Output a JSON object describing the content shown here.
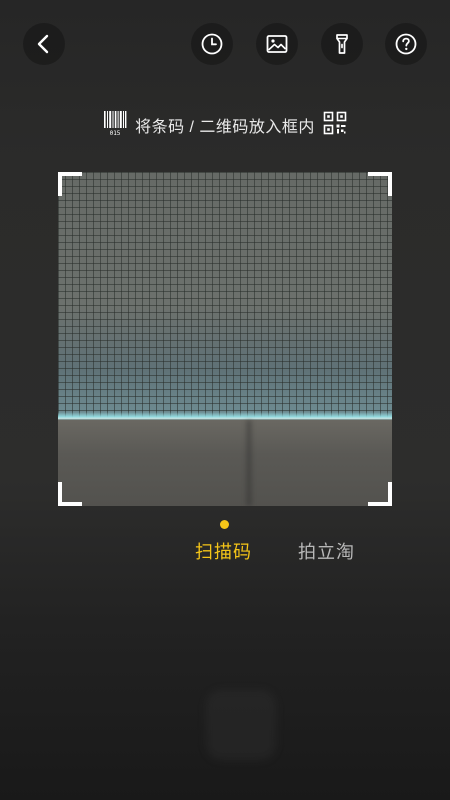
{
  "top_bar": {
    "back_icon": "chevron-left-icon",
    "history_icon": "clock-icon",
    "album_icon": "image-icon",
    "flashlight_icon": "flashlight-icon",
    "help_icon": "question-circle-icon"
  },
  "hint": {
    "text": "将条码 / 二维码放入框内",
    "barcode_icon": "barcode-icon",
    "barcode_caption": "015",
    "qrcode_icon": "qrcode-icon"
  },
  "modes": {
    "active_label": "扫描码",
    "inactive_label": "拍立淘"
  },
  "colors": {
    "accent": "#f5c518",
    "frame_corner": "#ffffff"
  }
}
